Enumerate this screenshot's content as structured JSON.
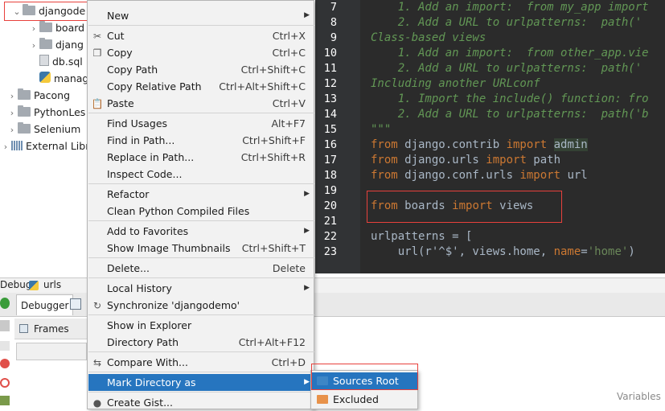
{
  "project_tree": {
    "items": [
      {
        "label": "djangode",
        "arrow": "⌄",
        "icon": "folder-icon"
      },
      {
        "label": "board",
        "arrow": "›",
        "icon": "folder-icon"
      },
      {
        "label": "djang",
        "arrow": "›",
        "icon": "folder-icon"
      },
      {
        "label": "db.sql",
        "arrow": "",
        "icon": "file-icon"
      },
      {
        "label": "manag",
        "arrow": "",
        "icon": "python-file-icon"
      },
      {
        "label": "Pacong",
        "arrow": "›",
        "icon": "folder-icon"
      },
      {
        "label": "PythonLes",
        "arrow": "›",
        "icon": "folder-icon"
      },
      {
        "label": "Selenium",
        "arrow": "›",
        "icon": "folder-icon"
      },
      {
        "label": "External Libra",
        "arrow": "›",
        "icon": "library-icon"
      }
    ]
  },
  "editor": {
    "lines": [
      {
        "n": "7",
        "parts": [
          {
            "t": "    1. Add an import:  from my_app import",
            "c": "cmt"
          }
        ]
      },
      {
        "n": "8",
        "parts": [
          {
            "t": "    2. Add a URL to urlpatterns:  path('",
            "c": "cmt"
          }
        ]
      },
      {
        "n": "9",
        "parts": [
          {
            "t": "Class-based views",
            "c": "cmt"
          }
        ]
      },
      {
        "n": "10",
        "parts": [
          {
            "t": "    1. Add an import:  from other_app.vie",
            "c": "cmt"
          }
        ]
      },
      {
        "n": "11",
        "parts": [
          {
            "t": "    2. Add a URL to urlpatterns:  path('",
            "c": "cmt"
          }
        ]
      },
      {
        "n": "12",
        "parts": [
          {
            "t": "Including another URLconf",
            "c": "cmt"
          }
        ]
      },
      {
        "n": "13",
        "parts": [
          {
            "t": "    1. Import the include() function: fro",
            "c": "cmt"
          }
        ]
      },
      {
        "n": "14",
        "parts": [
          {
            "t": "    2. Add a URL to urlpatterns:  path('b",
            "c": "cmt"
          }
        ]
      },
      {
        "n": "15",
        "parts": [
          {
            "t": "\"\"\"",
            "c": "cmt"
          }
        ]
      },
      {
        "n": "16",
        "parts": [
          {
            "t": "from",
            "c": "kw"
          },
          {
            "t": " django.contrib ",
            "c": ""
          },
          {
            "t": "import",
            "c": "kw"
          },
          {
            "t": " ",
            "c": ""
          },
          {
            "t": "admin",
            "c": "hl"
          }
        ]
      },
      {
        "n": "17",
        "parts": [
          {
            "t": "from",
            "c": "kw"
          },
          {
            "t": " django.urls ",
            "c": ""
          },
          {
            "t": "import",
            "c": "kw"
          },
          {
            "t": " path",
            "c": ""
          }
        ]
      },
      {
        "n": "18",
        "parts": [
          {
            "t": "from",
            "c": "kw"
          },
          {
            "t": " django.conf.urls ",
            "c": ""
          },
          {
            "t": "import",
            "c": "kw"
          },
          {
            "t": " url",
            "c": ""
          }
        ]
      },
      {
        "n": "19",
        "parts": []
      },
      {
        "n": "20",
        "parts": [
          {
            "t": "from",
            "c": "kw"
          },
          {
            "t": " boards ",
            "c": ""
          },
          {
            "t": "import",
            "c": "kw"
          },
          {
            "t": " views",
            "c": ""
          }
        ]
      },
      {
        "n": "21",
        "parts": []
      },
      {
        "n": "22",
        "parts": [
          {
            "t": "urlpatterns = [",
            "c": ""
          }
        ]
      },
      {
        "n": "23",
        "parts": [
          {
            "t": "    url(r'^$', views.home, ",
            "c": ""
          },
          {
            "t": "name",
            "c": "kw"
          },
          {
            "t": "=",
            "c": ""
          },
          {
            "t": "'home'",
            "c": "str"
          },
          {
            "t": ")",
            "c": ""
          }
        ]
      }
    ]
  },
  "debug": {
    "title": "Debug",
    "config": "urls",
    "tab_debugger": "Debugger",
    "frames_label": "Frames",
    "variables_label": "Variables"
  },
  "context_menu": {
    "items": [
      {
        "label": "New",
        "shortcut": "",
        "submenu": true,
        "icon": ""
      },
      {
        "sep": true
      },
      {
        "label": "Cut",
        "shortcut": "Ctrl+X",
        "icon": "scissors-icon"
      },
      {
        "label": "Copy",
        "shortcut": "Ctrl+C",
        "icon": "copy-icon"
      },
      {
        "label": "Copy Path",
        "shortcut": "Ctrl+Shift+C",
        "icon": ""
      },
      {
        "label": "Copy Relative Path",
        "shortcut": "Ctrl+Alt+Shift+C",
        "icon": ""
      },
      {
        "label": "Paste",
        "shortcut": "Ctrl+V",
        "icon": "paste-icon"
      },
      {
        "sep": true
      },
      {
        "label": "Find Usages",
        "shortcut": "Alt+F7",
        "icon": ""
      },
      {
        "label": "Find in Path...",
        "shortcut": "Ctrl+Shift+F",
        "icon": ""
      },
      {
        "label": "Replace in Path...",
        "shortcut": "Ctrl+Shift+R",
        "icon": ""
      },
      {
        "label": "Inspect Code...",
        "shortcut": "",
        "icon": ""
      },
      {
        "sep": true
      },
      {
        "label": "Refactor",
        "shortcut": "",
        "submenu": true,
        "icon": ""
      },
      {
        "label": "Clean Python Compiled Files",
        "shortcut": "",
        "icon": ""
      },
      {
        "sep": true
      },
      {
        "label": "Add to Favorites",
        "shortcut": "",
        "submenu": true,
        "icon": ""
      },
      {
        "label": "Show Image Thumbnails",
        "shortcut": "Ctrl+Shift+T",
        "icon": ""
      },
      {
        "sep": true
      },
      {
        "label": "Delete...",
        "shortcut": "Delete",
        "icon": ""
      },
      {
        "sep": true
      },
      {
        "label": "Local History",
        "shortcut": "",
        "submenu": true,
        "icon": ""
      },
      {
        "label": "Synchronize 'djangodemo'",
        "shortcut": "",
        "icon": "sync-icon"
      },
      {
        "sep": true
      },
      {
        "label": "Show in Explorer",
        "shortcut": "",
        "icon": ""
      },
      {
        "label": "Directory Path",
        "shortcut": "Ctrl+Alt+F12",
        "icon": ""
      },
      {
        "sep": true
      },
      {
        "label": "Compare With...",
        "shortcut": "Ctrl+D",
        "icon": "compare-icon"
      },
      {
        "sep": true
      },
      {
        "label": "Mark Directory as",
        "shortcut": "",
        "submenu": true,
        "icon": "",
        "active": true
      },
      {
        "sep": true
      },
      {
        "label": "Create Gist...",
        "shortcut": "",
        "icon": "github-icon"
      }
    ]
  },
  "submenu": {
    "items": [
      {
        "label": "Sources Root",
        "icon": "sources-folder-icon",
        "color": "#3d86c6",
        "active": true
      },
      {
        "label": "Excluded",
        "icon": "excluded-folder-icon",
        "color": "#e8924a"
      }
    ]
  },
  "colors": {
    "accent": "#2675bf",
    "annotation_red": "#e8413c",
    "editor_bg": "#2b2b2b"
  }
}
